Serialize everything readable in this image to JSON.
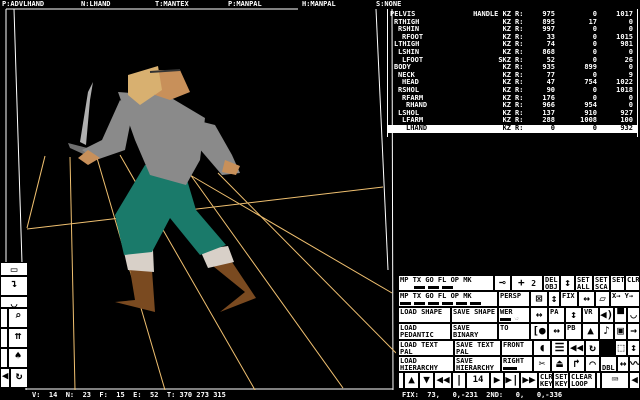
{
  "header": {
    "p1": "P:ADVLHAND",
    "n": "N:LHAND",
    "t": "T:MANTEX",
    "p2": "P:MANPAL",
    "h": "H:MANPAL",
    "s": "S:NONE"
  },
  "bones": [
    {
      "name": "PELVIS",
      "indent": 0,
      "flag": "HANDLE KZ",
      "r": "R:",
      "a": "975",
      "b": "0",
      "c": "1017"
    },
    {
      "name": "RTHIGH",
      "indent": 1,
      "flag": "KZ",
      "r": "R:",
      "a": "895",
      "b": "17",
      "c": "0"
    },
    {
      "name": "RSHIN",
      "indent": 2,
      "flag": "KZ",
      "r": "R:",
      "a": "997",
      "b": "0",
      "c": "0"
    },
    {
      "name": "RFOOT",
      "indent": 3,
      "flag": "KZ",
      "r": "R:",
      "a": "33",
      "b": "0",
      "c": "1015"
    },
    {
      "name": "LTHIGH",
      "indent": 1,
      "flag": "KZ",
      "r": "R:",
      "a": "74",
      "b": "0",
      "c": "981"
    },
    {
      "name": "LSHIN",
      "indent": 2,
      "flag": "KZ",
      "r": "R:",
      "a": "868",
      "b": "0",
      "c": "0"
    },
    {
      "name": "LFOOT",
      "indent": 3,
      "flag": "SKZ",
      "r": "R:",
      "a": "52",
      "b": "0",
      "c": "26"
    },
    {
      "name": "BODY",
      "indent": 1,
      "flag": "KZ",
      "r": "R:",
      "a": "935",
      "b": "899",
      "c": "0"
    },
    {
      "name": "NECK",
      "indent": 2,
      "flag": "KZ",
      "r": "R:",
      "a": "77",
      "b": "0",
      "c": "9"
    },
    {
      "name": "HEAD",
      "indent": 3,
      "flag": "KZ",
      "r": "R:",
      "a": "47",
      "b": "754",
      "c": "1022"
    },
    {
      "name": "RSHOL",
      "indent": 2,
      "flag": "KZ",
      "r": "R:",
      "a": "90",
      "b": "0",
      "c": "1018"
    },
    {
      "name": "RFARM",
      "indent": 3,
      "flag": "KZ",
      "r": "R:",
      "a": "176",
      "b": "0",
      "c": "0"
    },
    {
      "name": "RHAND",
      "indent": 4,
      "flag": "KZ",
      "r": "R:",
      "a": "966",
      "b": "954",
      "c": "0"
    },
    {
      "name": "LSHOL",
      "indent": 2,
      "flag": "KZ",
      "r": "R:",
      "a": "137",
      "b": "910",
      "c": "927"
    },
    {
      "name": "LFARM",
      "indent": 3,
      "flag": "KZ",
      "r": "R:",
      "a": "288",
      "b": "1008",
      "c": "100"
    },
    {
      "name": "LHAND",
      "indent": 4,
      "flag": "KZ",
      "r": "R:",
      "a": "0",
      "b": "0",
      "c": "932",
      "selected": true
    }
  ],
  "status": {
    "left": "V:  14  N:  23  F:  15  E:  52  T: 370 273 315",
    "right": "FIX:  73,   0,-231  2ND:   0,   0,-336"
  },
  "panel": {
    "mode_labels": [
      "MP",
      "TX",
      "GO",
      "FL",
      "OP",
      "MK"
    ],
    "del_obj": "DEL OBJ",
    "plus": "+",
    "two": "2",
    "minus": "-",
    "set_all": "SET ALL",
    "set_sca": "SET SCA",
    "set": "SET",
    "clr": "CLR",
    "persp": "PERSP",
    "fix": "FIX",
    "xy": "X→ Y→",
    "load_shape": "LOAD SHAPE",
    "save_shape": "SAVE SHAPE",
    "view": "WER",
    "pa": "PA",
    "vr": "VR",
    "load_pedantic": "LOAD PEDANTIC",
    "save_binary": "SAVE BINARY",
    "to": "TO",
    "pb": "PB",
    "load_text_pal": "LOAD TEXT  PAL",
    "save_text_pal": "SAVE TEXT  PAL",
    "front": "FRONT",
    "load_hierarchy": "LOAD HIERARCHY",
    "save_hierarchy": "SAVE HIERARCHY",
    "right": "RIGHT",
    "dbl": "DBL",
    "frame": "14",
    "clr_key": "CLR KEY",
    "set_key": "SET KEY",
    "clear_loop": "CLEAR LOOP"
  },
  "colors": {
    "grid": "#f0c070",
    "pants": "#1a7a6a",
    "armor": "#8a8a8a",
    "skin": "#c8905a",
    "boots": "#7a4a20"
  }
}
